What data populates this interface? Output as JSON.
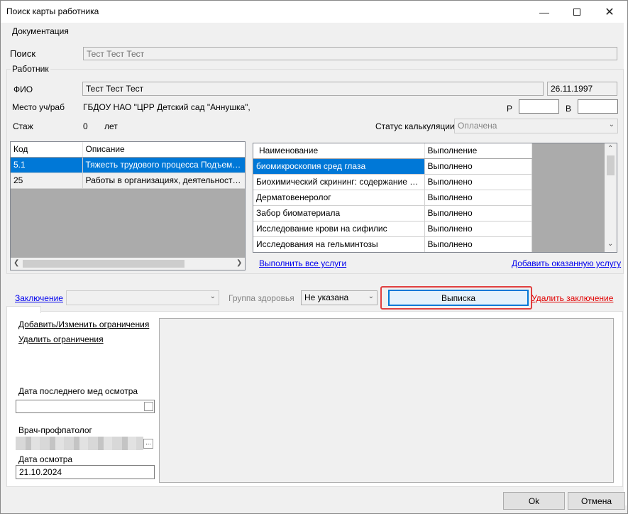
{
  "window": {
    "title": "Поиск карты работника"
  },
  "titlebar_icons": {
    "minimize": "minimize-icon",
    "maximize": "maximize-icon",
    "close": "close-icon"
  },
  "menu": {
    "documentation": "Документация"
  },
  "search": {
    "label": "Поиск",
    "value": "Тест Тест Тест"
  },
  "worker": {
    "group_label": "Работник",
    "fio_label": "ФИО",
    "fio_value": "Тест Тест Тест",
    "birth_date": "26.11.1997",
    "workplace_label": "Место уч/раб",
    "workplace_value": "ГБДОУ НАО \"ЦРР  Детский сад \"Аннушка\",",
    "p_label": "Р",
    "v_label": "В",
    "p_value": "",
    "v_value": "",
    "experience_label": "Стаж",
    "experience_value": "0",
    "experience_unit": "лет",
    "calc_status_label": "Статус калькуляции",
    "calc_status_value": "Оплачена"
  },
  "factors_grid": {
    "headers": [
      "Код",
      "Описание"
    ],
    "rows": [
      [
        "5.1",
        "Тяжесть трудового процесса Подъем, переме"
      ],
      [
        "25",
        "Работы в организациях, деятельность которых"
      ]
    ],
    "selected_row": 0
  },
  "services_grid": {
    "headers": [
      "Наименование",
      "Выполнение"
    ],
    "rows": [
      [
        "биомикроскопия сред глаза",
        "Выполнено"
      ],
      [
        "Биохимический скрининг: содержание в сыворотке",
        "Выполнено"
      ],
      [
        "Дерматовенеролог",
        "Выполнено"
      ],
      [
        "Забор биоматериала",
        "Выполнено"
      ],
      [
        "Исследование крови на сифилис",
        "Выполнено"
      ],
      [
        "Исследования на гельминтозы",
        "Выполнено"
      ]
    ],
    "selected_row": 0
  },
  "links": {
    "complete_all": "Выполнить все услуги",
    "add_service": "Добавить оказанную услугу",
    "conclusion": "Заключение",
    "delete_conclusion": "Удалить заключение",
    "add_edit_restrictions": "Добавить/Изменить ограничения",
    "delete_restrictions": "Удалить ограничения"
  },
  "conclusion": {
    "value": "",
    "health_group_label": "Группа здоровья",
    "health_group_value": "Не указана",
    "extract_button": "Выписка"
  },
  "exam": {
    "last_exam_label": "Дата последнего мед осмотра",
    "last_exam_value": "",
    "doctor_label": "Врач-профпатолог",
    "exam_date_label": "Дата осмотра",
    "exam_date_value": "21.10.2024"
  },
  "buttons": {
    "ok": "Ok",
    "cancel": "Отмена"
  },
  "colors": {
    "selection": "#0078d7",
    "link": "#0000ee",
    "danger_link": "#e00000",
    "highlight": "#e04040"
  }
}
